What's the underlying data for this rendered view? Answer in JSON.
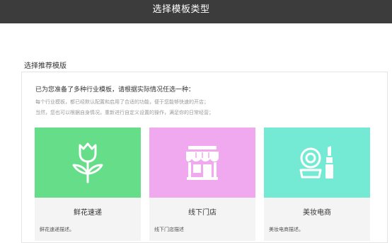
{
  "header": {
    "title": "选择模板类型"
  },
  "section": {
    "title": "选择推荐模版"
  },
  "intro": {
    "heading": "已为您准备了多种行业模板，请根据实际情况任选一种：",
    "line1": "每个行业模板，都已经默认配置和启用了合适的功能，便于您能够快速的开店；",
    "line2": "当然，您也可以根据自身情况，重新进行自定义设置的操作，满足你的日常经营；"
  },
  "cards": [
    {
      "title": "鲜花速递",
      "desc": "鲜花速递描述。",
      "color": "#66dd88",
      "icon": "rose-icon"
    },
    {
      "title": "线下门店",
      "desc": "线下门店描述",
      "color": "#f0a8ef",
      "icon": "storefront-icon"
    },
    {
      "title": "美妆电商",
      "desc": "美妆电商描述。",
      "color": "#74ead5",
      "icon": "cosmetics-icon"
    }
  ]
}
